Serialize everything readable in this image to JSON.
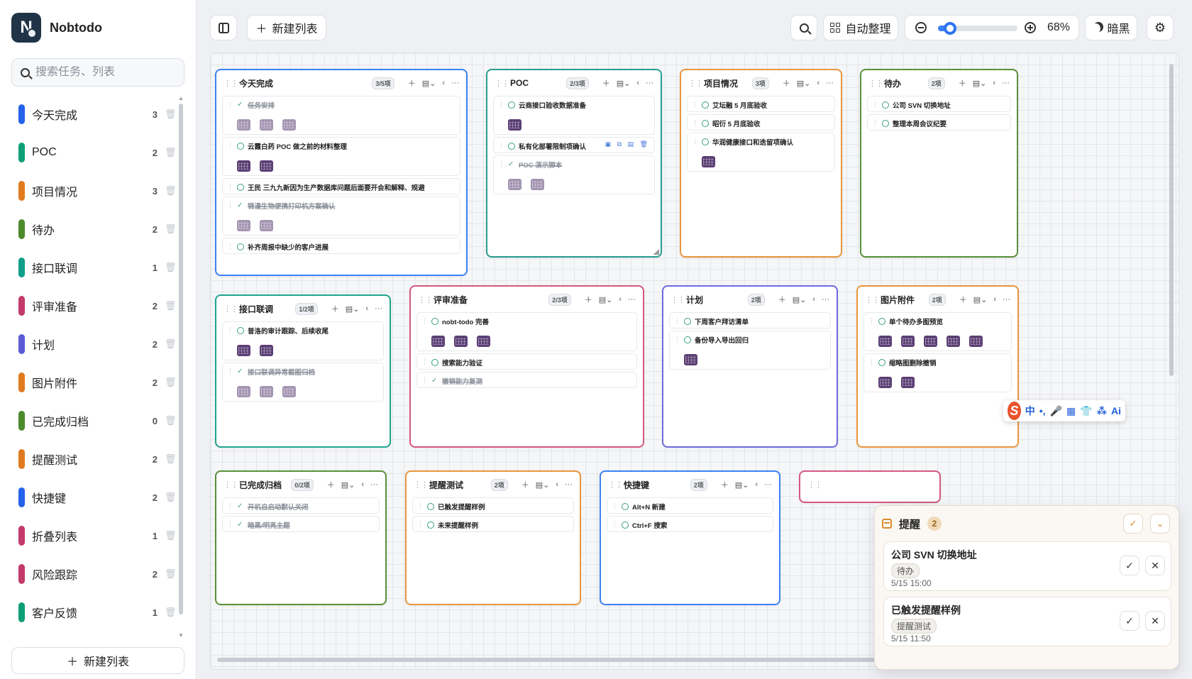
{
  "app": {
    "name": "Nobtodo",
    "logo_letter": "N"
  },
  "search": {
    "placeholder": "搜索任务、列表"
  },
  "sidebar": {
    "items": [
      {
        "label": "今天完成",
        "count": "3",
        "color": "#2563eb"
      },
      {
        "label": "POC",
        "count": "2",
        "color": "#0f9f77"
      },
      {
        "label": "项目情况",
        "count": "3",
        "color": "#e07b1f"
      },
      {
        "label": "待办",
        "count": "2",
        "color": "#4d8a2c"
      },
      {
        "label": "接口联调",
        "count": "1",
        "color": "#0f9f8a"
      },
      {
        "label": "评审准备",
        "count": "2",
        "color": "#c23b6b"
      },
      {
        "label": "计划",
        "count": "2",
        "color": "#5b5bd6"
      },
      {
        "label": "图片附件",
        "count": "2",
        "color": "#e07b1f"
      },
      {
        "label": "已完成归档",
        "count": "0",
        "color": "#4d8a2c"
      },
      {
        "label": "提醒测试",
        "count": "2",
        "color": "#e07b1f"
      },
      {
        "label": "快捷键",
        "count": "2",
        "color": "#2563eb"
      },
      {
        "label": "折叠列表",
        "count": "1",
        "color": "#c23b6b"
      },
      {
        "label": "风险跟踪",
        "count": "2",
        "color": "#c23b6b"
      },
      {
        "label": "客户反馈",
        "count": "1",
        "color": "#0f9f77"
      }
    ],
    "new_list_label": "新建列表"
  },
  "toolbar": {
    "new_list_label": "新建列表",
    "auto_arrange_label": "自动整理",
    "zoom_value": "68%",
    "zoom_fraction": 0.15,
    "theme_label": "暗黑"
  },
  "cards": [
    {
      "title": "今天完成",
      "badge": "3/5项",
      "color": "#3b82f6",
      "tasks": [
        {
          "text": "任务安排",
          "done": true,
          "thumbs": 3
        },
        {
          "text": "云霞白药 POC 做之前的材料整理",
          "done": false,
          "thumbs": 2
        },
        {
          "text": "王民 三九九新因为生产数据库问题后面要开会和解释、规避",
          "done": false,
          "thumbs": 0
        },
        {
          "text": "锦濠生物便携打印机方案确认",
          "done": true,
          "thumbs": 2
        },
        {
          "text": "补齐周报中缺少的客户进展",
          "done": false,
          "thumbs": 0
        }
      ]
    },
    {
      "title": "POC",
      "badge": "2/3项",
      "color": "#2a9d8f",
      "tasks": [
        {
          "text": "云商接口验收数据准备",
          "done": false,
          "thumbs": 1
        },
        {
          "text": "私有化部署限制项确认",
          "done": false,
          "thumbs": 0,
          "icons": "▣ ⧉ ▤ 🗑"
        },
        {
          "text": "POC 演示脚本",
          "done": true,
          "thumbs": 2
        }
      ]
    },
    {
      "title": "项目情况",
      "badge": "3项",
      "color": "#e9963d",
      "tasks": [
        {
          "text": "艾坛融 5 月底验收",
          "done": false,
          "thumbs": 0
        },
        {
          "text": "昭衍 5 月底验收",
          "done": false,
          "thumbs": 0
        },
        {
          "text": "华润健康接口和迭留项确认",
          "done": false,
          "thumbs": 1
        }
      ]
    },
    {
      "title": "待办",
      "badge": "2项",
      "color": "#5a8f3a",
      "tasks": [
        {
          "text": "公司 SVN 切换地址",
          "done": false,
          "thumbs": 0
        },
        {
          "text": "整理本周会议纪要",
          "done": false,
          "thumbs": 0
        }
      ]
    },
    {
      "title": "接口联调",
      "badge": "1/2项",
      "color": "#20a58f",
      "tasks": [
        {
          "text": "普洛的审计跟踪、后续收尾",
          "done": false,
          "thumbs": 2
        },
        {
          "text": "接口联调异常截图归档",
          "done": true,
          "thumbs": 3
        }
      ]
    },
    {
      "title": "评审准备",
      "badge": "2/3项",
      "color": "#d4587f",
      "tasks": [
        {
          "text": "nobt-todo 完善",
          "done": false,
          "thumbs": 3
        },
        {
          "text": "搜索能力验证",
          "done": false,
          "thumbs": 0
        },
        {
          "text": "撤销能力复测",
          "done": true,
          "thumbs": 0
        }
      ]
    },
    {
      "title": "计划",
      "badge": "2项",
      "color": "#6f6ae0",
      "tasks": [
        {
          "text": "下周客户拜访清单",
          "done": false,
          "thumbs": 0
        },
        {
          "text": "备份导入导出回归",
          "done": false,
          "thumbs": 1
        }
      ]
    },
    {
      "title": "图片附件",
      "badge": "2项",
      "color": "#e9963d",
      "tasks": [
        {
          "text": "单个待办多图预览",
          "done": false,
          "thumbs": 5
        },
        {
          "text": "缩略图删除撤销",
          "done": false,
          "thumbs": 2
        }
      ]
    },
    {
      "title": "已完成归档",
      "badge": "0/2项",
      "color": "#5a8f3a",
      "tasks": [
        {
          "text": "开机自启动默认关闭",
          "done": true,
          "thumbs": 0
        },
        {
          "text": "暗黑/明亮主题",
          "done": true,
          "thumbs": 0
        }
      ]
    },
    {
      "title": "提醒测试",
      "badge": "2项",
      "color": "#e9963d",
      "tasks": [
        {
          "text": "已触发提醒样例",
          "done": false,
          "thumbs": 0
        },
        {
          "text": "未来提醒样例",
          "done": false,
          "thumbs": 0
        }
      ]
    },
    {
      "title": "快捷键",
      "badge": "2项",
      "color": "#3b82f6",
      "tasks": [
        {
          "text": "Alt+N 新建",
          "done": false,
          "thumbs": 0
        },
        {
          "text": "Ctrl+F 搜索",
          "done": false,
          "thumbs": 0
        }
      ]
    },
    {
      "title": "",
      "badge": "",
      "color": "#d4587f",
      "tasks": []
    }
  ],
  "ime": {
    "logo": "S",
    "items": [
      "中",
      "•,",
      "🎤",
      "▦",
      "👕",
      "⁂",
      "Ai"
    ]
  },
  "reminders": {
    "title": "提醒",
    "count": "2",
    "items": [
      {
        "title": "公司 SVN 切换地址",
        "tag": "待办",
        "time": "5/15 15:00"
      },
      {
        "title": "已触发提醒样例",
        "tag": "提醒测试",
        "time": "5/15 11:50"
      }
    ]
  }
}
